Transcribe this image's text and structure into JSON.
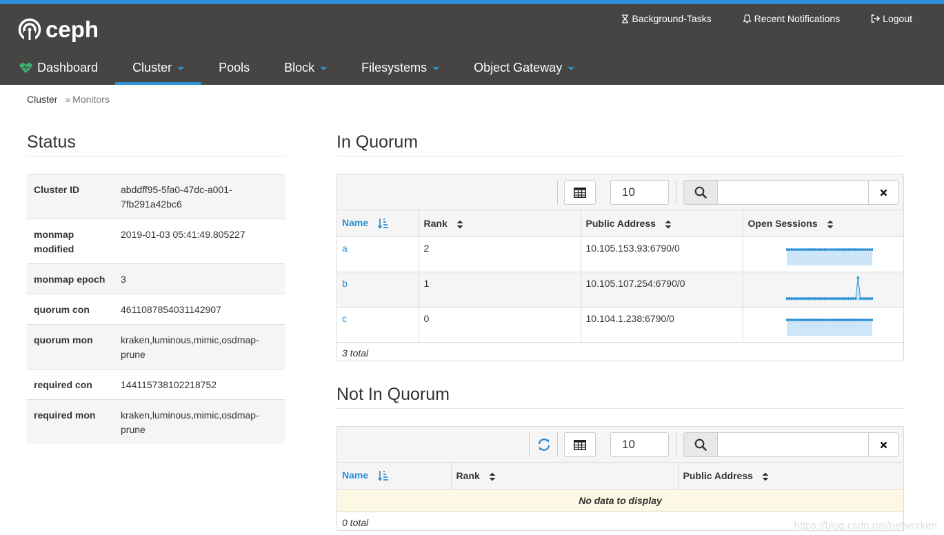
{
  "brand": {
    "name": "ceph"
  },
  "util_nav": [
    {
      "label": "Background-Tasks",
      "icon": "hourglass-icon"
    },
    {
      "label": "Recent Notifications",
      "icon": "bell-icon"
    },
    {
      "label": "Logout",
      "icon": "logout-icon"
    }
  ],
  "main_nav": [
    {
      "label": "Dashboard",
      "icon": "heart-icon",
      "active": false,
      "dropdown": false
    },
    {
      "label": "Cluster",
      "active": true,
      "dropdown": true
    },
    {
      "label": "Pools",
      "active": false,
      "dropdown": false
    },
    {
      "label": "Block",
      "active": false,
      "dropdown": true
    },
    {
      "label": "Filesystems",
      "active": false,
      "dropdown": true
    },
    {
      "label": "Object Gateway",
      "active": false,
      "dropdown": true
    }
  ],
  "breadcrumb": {
    "parent": "Cluster",
    "separator": "»",
    "current": "Monitors"
  },
  "status": {
    "title": "Status",
    "rows": [
      {
        "key": "Cluster ID",
        "value": "abddff95-5fa0-47dc-a001-7fb291a42bc6"
      },
      {
        "key": "monmap modified",
        "value": "2019-01-03 05:41:49.805227"
      },
      {
        "key": "monmap epoch",
        "value": "3"
      },
      {
        "key": "quorum con",
        "value": "4611087854031142907"
      },
      {
        "key": "quorum mon",
        "value": "kraken,luminous,mimic,osdmap-prune"
      },
      {
        "key": "required con",
        "value": "144115738102218752"
      },
      {
        "key": "required mon",
        "value": "kraken,luminous,mimic,osdmap-prune"
      }
    ]
  },
  "in_quorum": {
    "title": "In Quorum",
    "page_size": "10",
    "search_value": "",
    "columns": [
      "Name",
      "Rank",
      "Public Address",
      "Open Sessions"
    ],
    "rows": [
      {
        "name": "a",
        "rank": "2",
        "address": "10.105.153.93:6790/0",
        "sessions": [
          1,
          1,
          1,
          1,
          1,
          1,
          1,
          1,
          1,
          1,
          1,
          1,
          1,
          1,
          1,
          1,
          1,
          1,
          1,
          1,
          1,
          1,
          1,
          1,
          1,
          1,
          1,
          1,
          1,
          1,
          1,
          1,
          1,
          1,
          1,
          1,
          1
        ]
      },
      {
        "name": "b",
        "rank": "1",
        "address": "10.105.107.254:6790/0",
        "sessions": [
          0,
          0,
          0,
          0,
          0,
          0,
          0,
          0,
          0,
          0,
          0,
          0,
          0,
          0,
          0,
          0,
          0,
          0,
          0,
          0,
          0,
          0,
          0,
          0,
          0,
          0,
          0,
          0,
          0,
          0,
          1,
          0,
          0,
          0,
          0,
          0,
          0
        ]
      },
      {
        "name": "c",
        "rank": "0",
        "address": "10.104.1.238:6790/0",
        "sessions": [
          1,
          1,
          1,
          1,
          1,
          1,
          1,
          1,
          1,
          1,
          1,
          1,
          1,
          1,
          1,
          1,
          1,
          1,
          1,
          1,
          1,
          1,
          1,
          1,
          1,
          1,
          1,
          1,
          1,
          1,
          1,
          1,
          1,
          1,
          1,
          1,
          1
        ]
      }
    ],
    "footer": "3 total"
  },
  "not_in_quorum": {
    "title": "Not In Quorum",
    "page_size": "10",
    "search_value": "",
    "columns": [
      "Name",
      "Rank",
      "Public Address"
    ],
    "empty_message": "No data to display",
    "footer": "0 total"
  },
  "watermark": "https://blog.csdn.net/networken",
  "colors": {
    "navbar": "#474544",
    "accent": "#2b8ed6",
    "heart": "#3cb371",
    "spark_fill": "#cce6f8"
  }
}
